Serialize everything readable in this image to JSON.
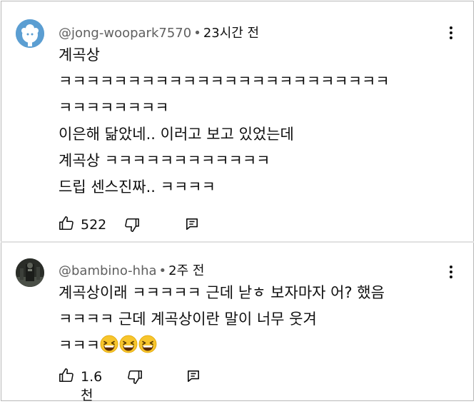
{
  "comments": [
    {
      "author": "@jong-woopark7570",
      "time": "23시간 전",
      "lines": [
        "계곡상",
        "ㅋㅋㅋㅋㅋㅋㅋㅋㅋㅋㅋㅋㅋㅋㅋㅋㅋㅋㅋㅋㅋㅋㅋㅋ",
        "ㅋㅋㅋㅋㅋㅋㅋㅋ",
        "이은해 닮았네.. 이러고 보고 있었는데",
        "계곡상 ㅋㅋㅋㅋㅋㅋㅋㅋㅋㅋㅋㅋ",
        "드립 센스진짜.. ㅋㅋㅋㅋ"
      ],
      "like_count": "522"
    },
    {
      "author": "@bambino-hha",
      "time": "2주 전",
      "lines": [
        "계곡상이래 ㅋㅋㅋㅋㅋ 근데 낟ㅎ 보자마자 어? 했음",
        "ㅋㅋㅋㅋ 근데 계곡상이란 말이 너무 웃겨",
        "ㅋㅋㅋ"
      ],
      "emoji_count": 3,
      "like_count": "1.6천"
    }
  ],
  "icons": {
    "like": "thumbs-up-icon",
    "dislike": "thumbs-down-icon",
    "reply": "reply-icon",
    "menu": "more-vert-icon",
    "emoji": "grinning-squinting-face-emoji"
  },
  "colors": {
    "meta": "#606060",
    "text": "#0f0f0f"
  }
}
